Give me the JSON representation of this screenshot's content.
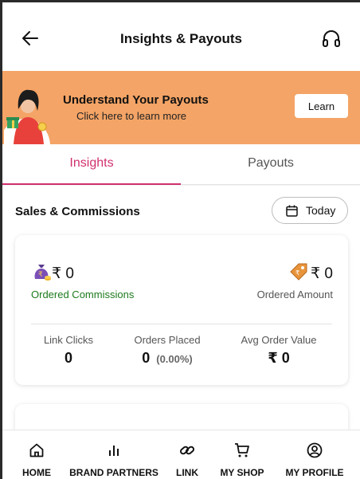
{
  "header": {
    "title": "Insights & Payouts",
    "back_icon": "back-arrow-icon",
    "support_icon": "headphones-icon"
  },
  "banner": {
    "title": "Understand Your Payouts",
    "subtitle": "Click here to learn more",
    "button_label": "Learn",
    "background_color": "#f4a466"
  },
  "tabs": [
    {
      "label": "Insights",
      "active": true
    },
    {
      "label": "Payouts",
      "active": false
    }
  ],
  "accent_color": "#d0306e",
  "sales": {
    "title": "Sales & Commissions",
    "period_label": "Today",
    "period_icon": "calendar-icon",
    "commissions": {
      "amount": "₹ 0",
      "label": "Ordered Commissions",
      "icon": "money-bag-icon"
    },
    "ordered_amount": {
      "amount": "₹ 0",
      "label": "Ordered Amount",
      "icon": "price-tag-icon"
    },
    "stats": [
      {
        "label": "Link Clicks",
        "value": "0"
      },
      {
        "label": "Orders Placed",
        "value": "0",
        "extra": "(0.00%)"
      },
      {
        "label": "Avg Order Value",
        "value": "₹ 0"
      }
    ]
  },
  "bottom_nav": [
    {
      "label": "HOME",
      "icon": "home-icon"
    },
    {
      "label": "BRAND PARTNERS",
      "icon": "bar-chart-icon"
    },
    {
      "label": "LINK",
      "icon": "link-icon"
    },
    {
      "label": "MY SHOP",
      "icon": "cart-icon"
    },
    {
      "label": "MY PROFILE",
      "icon": "profile-icon"
    }
  ]
}
